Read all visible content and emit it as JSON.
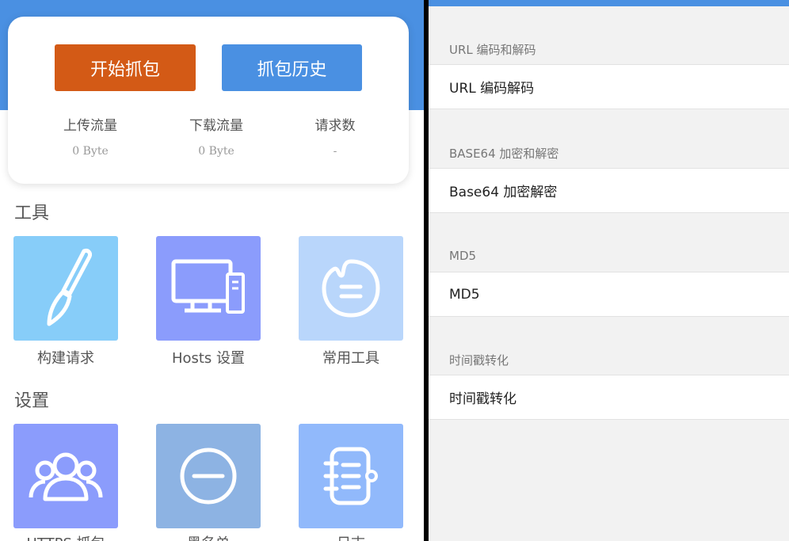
{
  "left": {
    "start_button": "开始抓包",
    "history_button": "抓包历史",
    "stats": [
      {
        "label": "上传流量",
        "value": "0 Byte"
      },
      {
        "label": "下载流量",
        "value": "0 Byte"
      },
      {
        "label": "请求数",
        "value": "-"
      }
    ],
    "tools_title": "工具",
    "tools": [
      {
        "label": "构建请求",
        "icon": "brush-icon",
        "color": "#87cdf9"
      },
      {
        "label": "Hosts 设置",
        "icon": "computer-icon",
        "color": "#8b9cfc"
      },
      {
        "label": "常用工具",
        "icon": "palette-icon",
        "color": "#b9d6fb"
      }
    ],
    "settings_title": "设置",
    "settings": [
      {
        "label": "HTTPS 抓包",
        "icon": "users-icon",
        "color": "#8b9cfc"
      },
      {
        "label": "黑名单",
        "icon": "minus-circle-icon",
        "color": "#8db3e3"
      },
      {
        "label": "日志",
        "icon": "notebook-icon",
        "color": "#91b9fb"
      }
    ]
  },
  "right": {
    "groups": [
      {
        "header": "URL 编码和解码",
        "item": "URL 编码解码"
      },
      {
        "header": "BASE64 加密和解密",
        "item": "Base64 加密解密"
      },
      {
        "header": "MD5",
        "item": "MD5"
      },
      {
        "header": "时间戳转化",
        "item": "时间戳转化"
      }
    ]
  },
  "colors": {
    "primary_blue": "#4a90e2",
    "start_orange": "#d35a16"
  }
}
